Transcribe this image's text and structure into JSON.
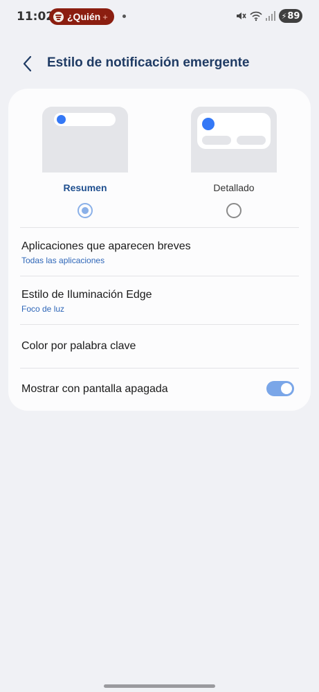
{
  "status_bar": {
    "time": "11:02",
    "media_label": "¿Quién",
    "media_plus": "+",
    "battery": "89"
  },
  "header": {
    "title": "Estilo de notificación emergente"
  },
  "styles": {
    "summary_label": "Resumen",
    "detailed_label": "Detallado",
    "selected": "Resumen"
  },
  "settings": {
    "apps_title": "Aplicaciones que aparecen breves",
    "apps_sub": "Todas las aplicaciones",
    "edge_title": "Estilo de Iluminación Edge",
    "edge_sub": "Foco de luz",
    "keyword_title": "Color por palabra clave",
    "aod_title": "Mostrar con pantalla apagada",
    "aod_enabled": true
  },
  "colors": {
    "accent": "#3478f6",
    "title": "#1f3b64",
    "link": "#2e66b8",
    "media_pill": "#8b1e10"
  }
}
